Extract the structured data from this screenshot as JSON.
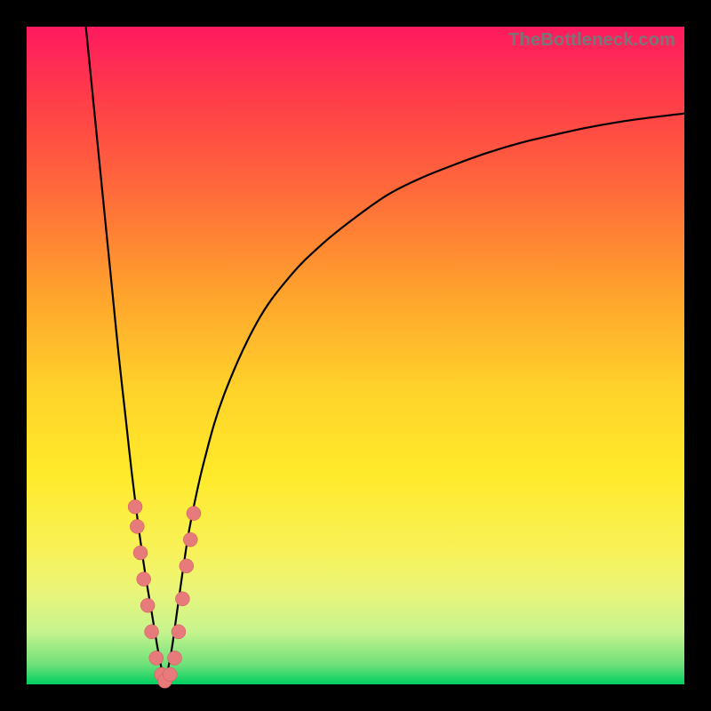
{
  "watermark": "TheBottleneck.com",
  "colors": {
    "gradient_top": "#ff1a5f",
    "gradient_mid": "#ffd22a",
    "gradient_bottom": "#00d060",
    "curve": "#000000",
    "marker_fill": "#e77b7b",
    "marker_stroke": "#cc5555",
    "frame": "#000000"
  },
  "chart_data": {
    "type": "line",
    "title": "",
    "xlabel": "",
    "ylabel": "",
    "xlim": [
      0,
      100
    ],
    "ylim": [
      0,
      100
    ],
    "series": [
      {
        "name": "left-branch",
        "x": [
          9,
          10,
          11,
          12,
          13,
          14,
          15,
          16,
          17,
          18,
          19,
          20,
          21
        ],
        "y": [
          100,
          90,
          80,
          70,
          60,
          50,
          41,
          32,
          24,
          17,
          11,
          5,
          0
        ]
      },
      {
        "name": "right-branch",
        "x": [
          21,
          22,
          23,
          24,
          25,
          27,
          30,
          35,
          40,
          45,
          50,
          55,
          60,
          65,
          70,
          75,
          80,
          85,
          90,
          95,
          100
        ],
        "y": [
          0,
          5,
          12,
          19,
          25,
          34,
          44,
          55,
          62,
          67,
          71,
          74.5,
          77,
          79,
          80.8,
          82.3,
          83.5,
          84.6,
          85.5,
          86.2,
          86.8
        ]
      }
    ],
    "markers": {
      "name": "near-valley-points",
      "points": [
        {
          "x": 16.5,
          "y": 27
        },
        {
          "x": 16.8,
          "y": 24
        },
        {
          "x": 17.3,
          "y": 20
        },
        {
          "x": 17.8,
          "y": 16
        },
        {
          "x": 18.4,
          "y": 12
        },
        {
          "x": 19.0,
          "y": 8
        },
        {
          "x": 19.7,
          "y": 4
        },
        {
          "x": 20.5,
          "y": 1.5
        },
        {
          "x": 21.0,
          "y": 0.5
        },
        {
          "x": 21.8,
          "y": 1.5
        },
        {
          "x": 22.5,
          "y": 4
        },
        {
          "x": 23.1,
          "y": 8
        },
        {
          "x": 23.7,
          "y": 13
        },
        {
          "x": 24.3,
          "y": 18
        },
        {
          "x": 24.9,
          "y": 22
        },
        {
          "x": 25.4,
          "y": 26
        }
      ]
    }
  }
}
